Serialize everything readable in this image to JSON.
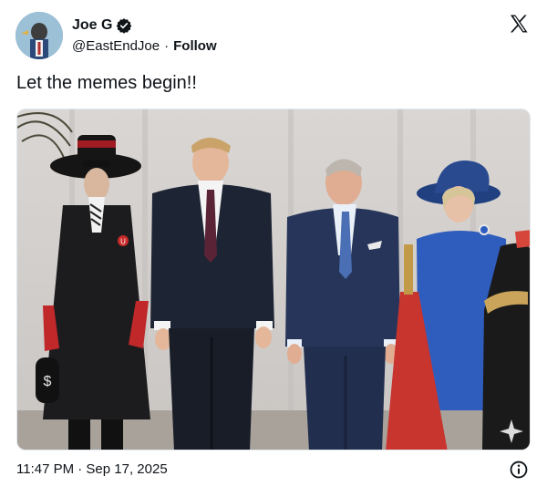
{
  "author": {
    "display_name": "Joe G",
    "handle": "@EastEndJoe",
    "separator": "·",
    "follow_label": "Follow",
    "verified": true
  },
  "tweet": {
    "text": "Let the memes begin!!",
    "timestamp": "11:47 PM · Sep 17, 2025"
  },
  "icons": {
    "verified": "verified-badge-icon",
    "platform": "x-logo-icon",
    "info": "info-icon",
    "sparkle": "sparkle-icon"
  },
  "media": {
    "badge_letter": "U",
    "bag_symbol": "$"
  },
  "colors": {
    "text": "#0f1419",
    "verified_badge": "#0f1419"
  }
}
